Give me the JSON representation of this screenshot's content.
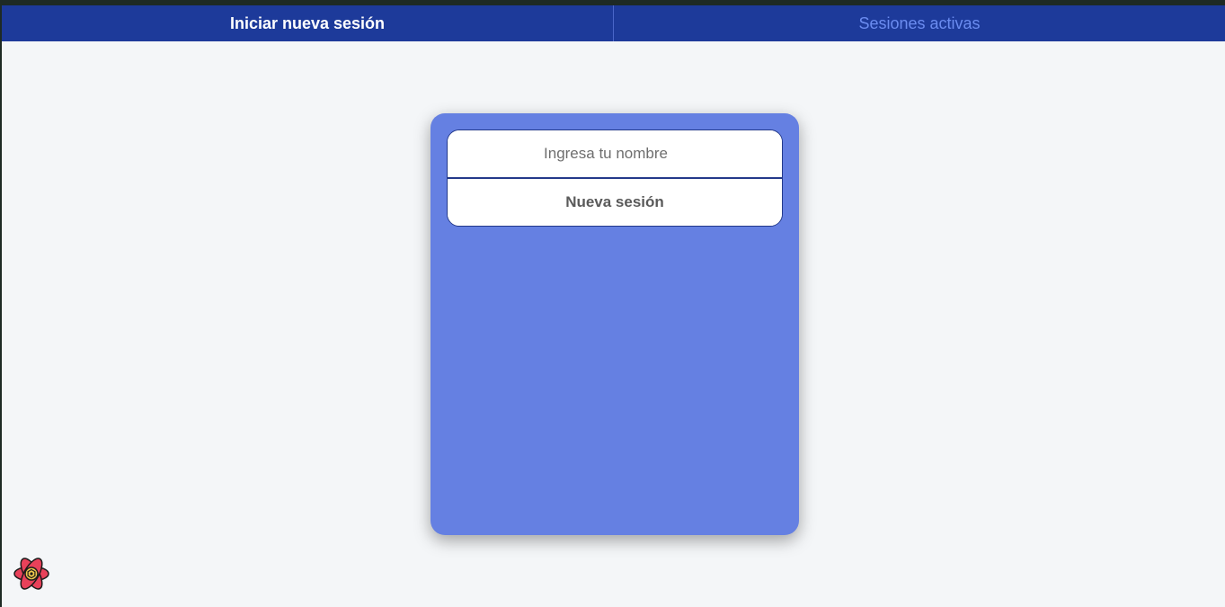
{
  "tabs": [
    {
      "label": "Iniciar nueva sesión",
      "active": true
    },
    {
      "label": "Sesiones activas",
      "active": false
    }
  ],
  "form": {
    "name_placeholder": "Ingresa tu nombre",
    "name_value": "",
    "submit_label": "Nueva sesión"
  },
  "devtools": {
    "icon": "react-query-devtools-icon"
  },
  "colors": {
    "topbar": "#1d3a9a",
    "card": "#6580e2",
    "background": "#f4f6f8",
    "inactive_tab": "#6b8cf0"
  }
}
